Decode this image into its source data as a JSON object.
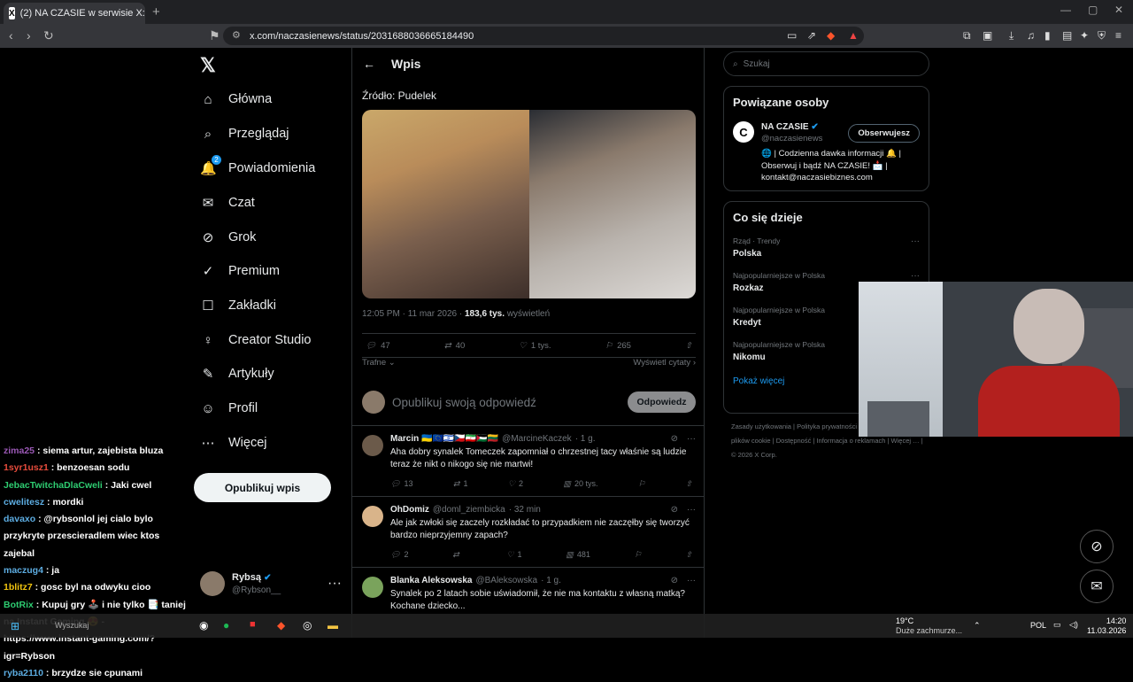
{
  "browser": {
    "tab_title": "(2) NA CZASIE w serwisie X: „...",
    "url": "x.com/naczasienews/status/2031688036665184490"
  },
  "chat": [
    {
      "user": "zima25",
      "color": "#9b59b6",
      "text": "siema artur, zajebista bluza"
    },
    {
      "user": "1syr1usz1",
      "color": "#e74c3c",
      "text": "benzoesan sodu"
    },
    {
      "user": "JebacTwitchaDlaCweli",
      "color": "#2ecc71",
      "text": "Jaki cwel"
    },
    {
      "user": "cwelitesz",
      "color": "#5dade2",
      "text": "mordki"
    },
    {
      "user": "davaxo",
      "color": "#5dade2",
      "text": "@rybsonlol jej cialo bylo przykryte przescieradlem wiec ktos zajebal"
    },
    {
      "user": "maczug4",
      "color": "#5dade2",
      "text": "ja"
    },
    {
      "user": "1blitz7",
      "color": "#f1c40f",
      "text": "gosc byl na odwyku cioo"
    },
    {
      "user": "BotRix",
      "color": "#2ecc71",
      "text": "Kupuj gry 🕹️ i nie tylko 📑 taniej na Instant Gaming 😍 - https://www.instant-gaming.com/?igr=Rybson"
    },
    {
      "user": "ryba2110",
      "color": "#5dade2",
      "text": "brzydze sie cpunami"
    }
  ],
  "nav": {
    "items": [
      {
        "label": "Główna",
        "icon": "home-icon",
        "glyph": "⌂"
      },
      {
        "label": "Przeglądaj",
        "icon": "search-icon",
        "glyph": "⌕"
      },
      {
        "label": "Powiadomienia",
        "icon": "bell-icon",
        "glyph": "🔔",
        "badge": "2"
      },
      {
        "label": "Czat",
        "icon": "mail-icon",
        "glyph": "✉"
      },
      {
        "label": "Grok",
        "icon": "grok-icon",
        "glyph": "⊘"
      },
      {
        "label": "Premium",
        "icon": "premium-icon",
        "glyph": "✓"
      },
      {
        "label": "Zakładki",
        "icon": "bookmark-icon",
        "glyph": "☐"
      },
      {
        "label": "Creator Studio",
        "icon": "creator-icon",
        "glyph": "♀"
      },
      {
        "label": "Artykuły",
        "icon": "article-icon",
        "glyph": "✎"
      },
      {
        "label": "Profil",
        "icon": "profile-icon",
        "glyph": "☺"
      },
      {
        "label": "Więcej",
        "icon": "more-icon",
        "glyph": "⋯"
      }
    ],
    "post_button": "Opublikuj wpis"
  },
  "account": {
    "name": "Rybsą",
    "handle": "@Rybson__"
  },
  "main": {
    "header": "Wpis",
    "source": "Źródło: Pudelek",
    "time": "12:05 PM · 11 mar 2026 ·",
    "views": "183,6 tys.",
    "views_label": "wyświetleń",
    "stats": {
      "replies": "47",
      "reposts": "40",
      "likes": "1 tys.",
      "bookmarks": "265"
    },
    "sort": "Trafne",
    "quotes": "Wyświetl cytaty",
    "composer_placeholder": "Opublikuj swoją odpowiedź",
    "reply_button": "Odpowiedz"
  },
  "replies": [
    {
      "name": "Marcin 🇺🇦🇪🇺🇮🇱🇨🇿🇮🇷🇵🇸🇱🇹",
      "handle": "@MarcineKaczek",
      "time": "· 1 g.",
      "text": "Aha dobry synalek Tomeczek zapomniał o chrzestnej tacy właśnie są ludzie teraz że nikt o nikogo się nie martwi!",
      "replies": "13",
      "reposts": "1",
      "likes": "2",
      "views": "20 tys."
    },
    {
      "name": "OhDomiz",
      "handle": "@doml_ziembicka",
      "time": "· 32 min",
      "text": "Ale jak zwłoki się zaczely rozkładać to przypadkiem nie zaczęłby się tworzyć bardzo nieprzyjemny zapach?",
      "replies": "2",
      "reposts": "",
      "likes": "1",
      "views": "481"
    },
    {
      "name": "Blanka Aleksowska",
      "handle": "@BAleksowska",
      "time": "· 1 g.",
      "text": "Synalek po 2 latach sobie uświadomił, że nie ma kontaktu z własną matką? Kochane dziecko...",
      "replies": "",
      "reposts": "",
      "likes": "",
      "views": ""
    }
  ],
  "right": {
    "search_placeholder": "Szukaj",
    "related_title": "Powiązane osoby",
    "related": {
      "name": "NA CZASIE",
      "handle": "@naczasienews",
      "follow": "Obserwujesz",
      "bio": "🌐 | Codzienna dawka informacji 🔔 | Obserwuj i bądź NA CZASIE! 📩 | kontakt@naczasiebiznes.com"
    },
    "trends_title": "Co się dzieje",
    "trends": [
      {
        "category": "Rząd · Trendy",
        "name": "Polska"
      },
      {
        "category": "Najpopularniejsze w Polska",
        "name": "Rozkaz"
      },
      {
        "category": "Najpopularniejsze w Polska",
        "name": "Kredyt"
      },
      {
        "category": "Najpopularniejsze w Polska",
        "name": "Nikomu"
      }
    ],
    "show_more": "Pokaż więcej",
    "footer": [
      "Zasady użytkowania",
      "Polityka prywatności",
      "Polityka dotycząca plików cookie",
      "Dostępność",
      "Informacja o reklamach",
      "Więcej …",
      "© 2026 X Corp."
    ]
  },
  "taskbar": {
    "weather_temp": "19°C",
    "weather_desc": "Duże zachmurze...",
    "lang": "POL",
    "time": "14:20",
    "date": "11.03.2026",
    "search": "Wyszukaj"
  },
  "colors": {
    "accent": "#1d9bf0",
    "bg": "#000000",
    "border": "#2f3336",
    "muted": "#71767b"
  }
}
